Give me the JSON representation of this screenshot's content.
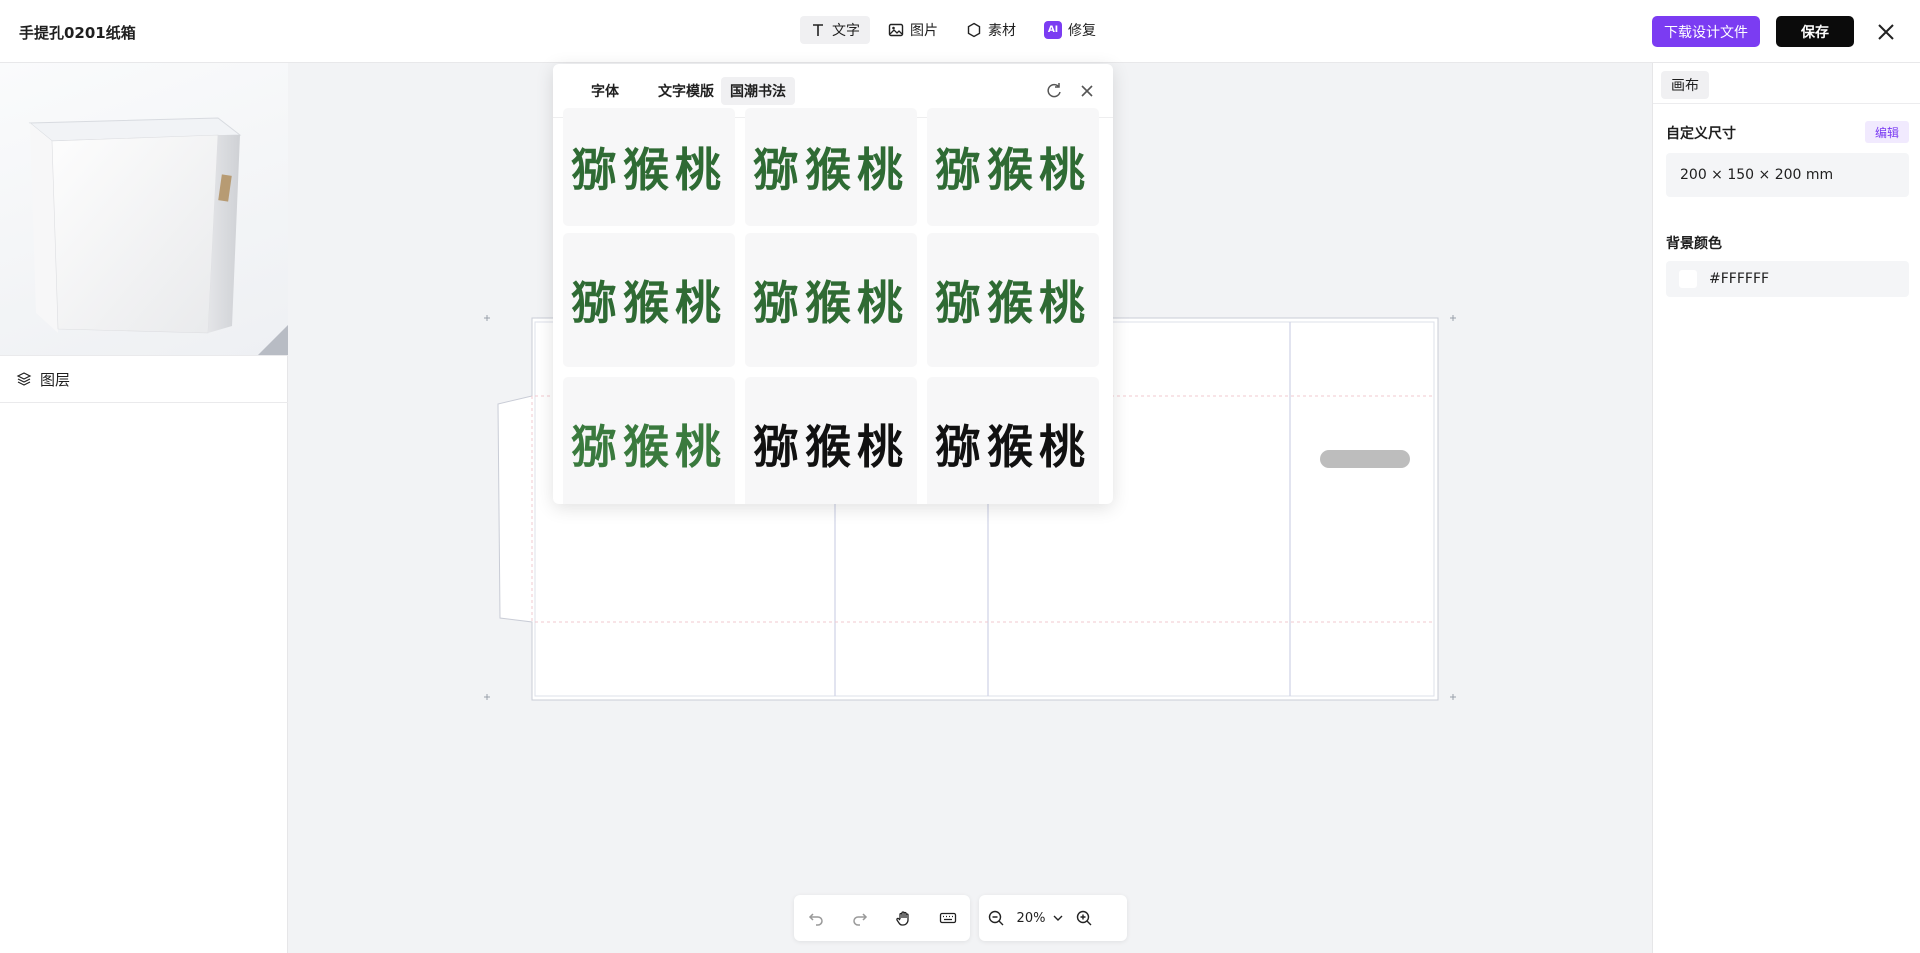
{
  "header": {
    "doc_title": "手提孔0201纸箱",
    "tools": [
      {
        "label": "文字",
        "icon": "text-icon",
        "active": true
      },
      {
        "label": "图片",
        "icon": "image-icon",
        "active": false
      },
      {
        "label": "素材",
        "icon": "hexagon-icon",
        "active": false
      },
      {
        "label": "修复",
        "icon": "ai-icon",
        "badge": "AI",
        "active": false
      }
    ],
    "download_label": "下载设计文件",
    "save_label": "保存"
  },
  "left_panel": {
    "layers_title": "图层"
  },
  "font_popup": {
    "tabs": [
      {
        "label": "字体",
        "active": false
      },
      {
        "label": "文字模版",
        "active": false
      },
      {
        "label": "国潮书法",
        "active": true
      }
    ],
    "samples": [
      {
        "text": "猕猴桃",
        "color": "#2f6b34"
      },
      {
        "text": "猕猴桃",
        "color": "#2f6b34"
      },
      {
        "text": "猕猴桃",
        "color": "#2f6b34"
      },
      {
        "text": "猕猴桃",
        "color": "#2f6b34"
      },
      {
        "text": "猕猴桃",
        "color": "#2f6b34"
      },
      {
        "text": "猕猴桃",
        "color": "#2f6b34"
      },
      {
        "text": "猕猴桃",
        "color": "#3a7a3e"
      },
      {
        "text": "猕猴桃",
        "color": "#111111"
      },
      {
        "text": "猕猴桃",
        "color": "#111111"
      }
    ]
  },
  "right_panel": {
    "tab_label": "画布",
    "size_label": "自定义尺寸",
    "edit_label": "编辑",
    "size_value": "200 × 150 × 200 mm",
    "bg_label": "背景颜色",
    "bg_value": "#FFFFFF"
  },
  "bottom_toolbar": {
    "zoom": "20%"
  },
  "colors": {
    "accent": "#7b3cf2",
    "save": "#0b0b0b"
  }
}
